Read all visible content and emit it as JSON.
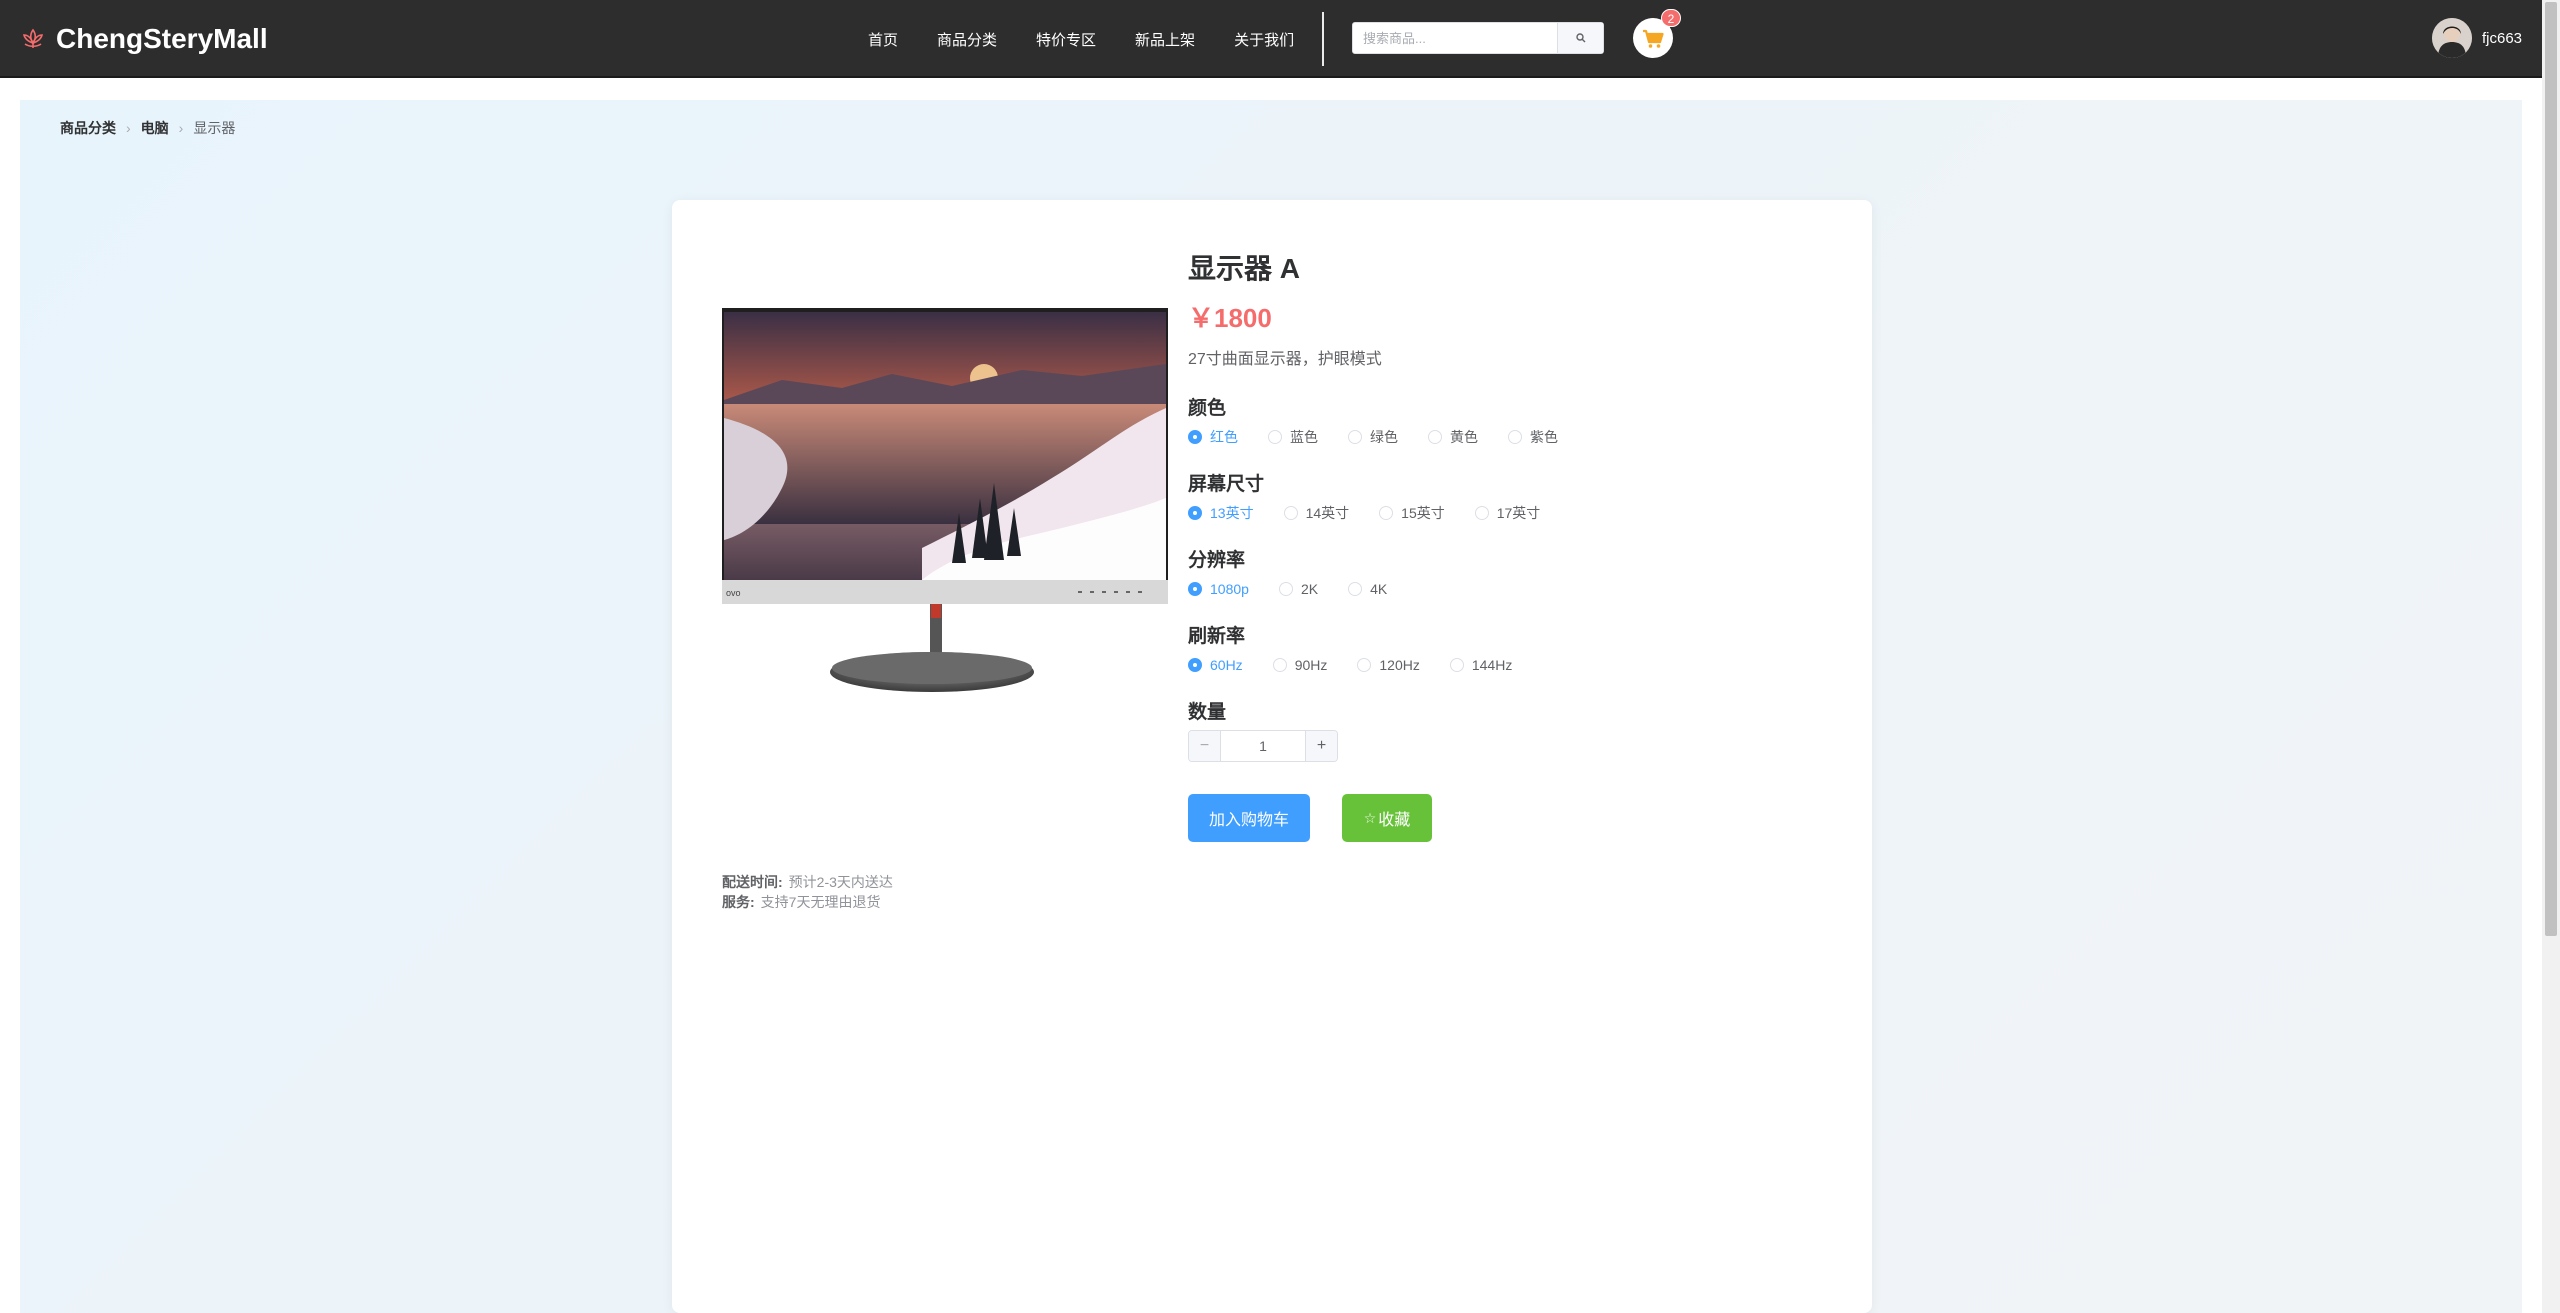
{
  "header": {
    "brand": "ChengSteryMall",
    "nav": [
      "首页",
      "商品分类",
      "特价专区",
      "新品上架",
      "关于我们"
    ],
    "search_placeholder": "搜索商品...",
    "cart_count": "2",
    "username": "fjc663"
  },
  "breadcrumb": {
    "items": [
      "商品分类",
      "电脑"
    ],
    "current": "显示器"
  },
  "product": {
    "name": "显示器 A",
    "price": "￥1800",
    "description": "27寸曲面显示器，护眼模式",
    "options": [
      {
        "label": "颜色",
        "values": [
          "红色",
          "蓝色",
          "绿色",
          "黄色",
          "紫色"
        ],
        "selected": 0
      },
      {
        "label": "屏幕尺寸",
        "values": [
          "13英寸",
          "14英寸",
          "15英寸",
          "17英寸"
        ],
        "selected": 0
      },
      {
        "label": "分辨率",
        "values": [
          "1080p",
          "2K",
          "4K"
        ],
        "selected": 0
      },
      {
        "label": "刷新率",
        "values": [
          "60Hz",
          "90Hz",
          "120Hz",
          "144Hz"
        ],
        "selected": 0
      }
    ],
    "quantity_label": "数量",
    "quantity": "1",
    "add_to_cart": "加入购物车",
    "favorite": "收藏",
    "delivery": {
      "time_label": "配送时间:",
      "time_value": "预计2-3天内送达",
      "service_label": "服务:",
      "service_value": "支持7天无理由退货"
    }
  },
  "colors": {
    "header_bg": "#2d2d2d",
    "primary": "#409eff",
    "price": "#f56c6c",
    "favorite": "#67c23a"
  },
  "icons": [
    "lotus-logo-icon",
    "search-icon",
    "cart-icon",
    "chevron-right-icon",
    "minus-icon",
    "plus-icon",
    "star-icon"
  ]
}
